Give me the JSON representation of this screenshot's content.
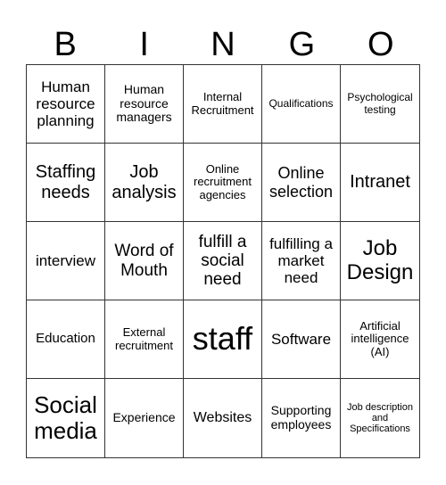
{
  "header": {
    "letters": [
      "B",
      "I",
      "N",
      "G",
      "O"
    ]
  },
  "cells": [
    "Human resource planning",
    "Human resource managers",
    "Internal Recruitment",
    "Qualifications",
    "Psychological testing",
    "Staffing needs",
    "Job analysis",
    "Online recruitment agencies",
    "Online selection",
    "Intranet",
    "interview",
    "Word of Mouth",
    "fulfill a social need",
    "fulfilling a market need",
    "Job Design",
    "Education",
    "External recruitment",
    "staff",
    "Software",
    "Artificial intelligence (AI)",
    "Social media",
    "Experience",
    "Websites",
    "Supporting employees",
    "Job description and Specifications"
  ]
}
